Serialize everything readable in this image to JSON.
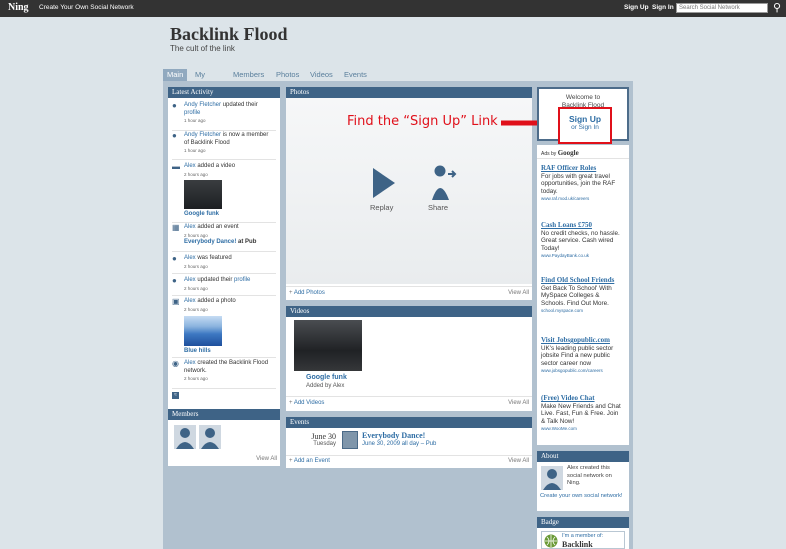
{
  "topbar": {
    "logo": "Ning",
    "create_link": "Create Your Own Social Network",
    "sign_up": "Sign Up",
    "sign_in": "Sign In",
    "search_placeholder": "Search Social Network"
  },
  "site": {
    "title": "Backlink Flood",
    "tagline": "The cult of the link"
  },
  "tabs": [
    "Main",
    "My Page",
    "Members",
    "Photos",
    "Videos",
    "Events"
  ],
  "latest_activity": {
    "header": "Latest Activity",
    "items": [
      {
        "actor": "Andy Fletcher",
        "text": "updated their",
        "link": "profile",
        "time": "1 hour ago"
      },
      {
        "actor": "Andy Fletcher",
        "text": "is now a member of Backlink Flood",
        "time": "1 hour ago"
      },
      {
        "actor": "Alex",
        "text": "added a video",
        "time": "2 hours ago",
        "caption": "Google funk"
      },
      {
        "actor": "Alex",
        "text": "added an event",
        "time": "2 hours ago",
        "caption": "Everybody Dance!",
        "caption_suffix": "at Pub"
      },
      {
        "actor": "Alex",
        "text": "was featured",
        "time": "2 hours ago"
      },
      {
        "actor": "Alex",
        "text": "updated their",
        "link": "profile",
        "time": "2 hours ago"
      },
      {
        "actor": "Alex",
        "text": "added a photo",
        "time": "2 hours ago",
        "caption": "Blue hills"
      },
      {
        "actor": "Alex",
        "text": "created the Backlink Flood network.",
        "time": "2 hours ago"
      }
    ]
  },
  "members": {
    "header": "Members",
    "view_all": "View All"
  },
  "photos": {
    "header": "Photos",
    "replay": "Replay",
    "share": "Share",
    "add": "Add Photos",
    "view_all": "View All"
  },
  "videos": {
    "header": "Videos",
    "title": "Google funk",
    "added_by": "Added by Alex",
    "add": "Add Videos",
    "view_all": "View All"
  },
  "events": {
    "header": "Events",
    "date": "June 30",
    "weekday": "Tuesday",
    "title": "Everybody Dance!",
    "detail": "June 30, 2009 all day – Pub",
    "add": "Add an Event",
    "view_all": "View All"
  },
  "annotation": {
    "text": "Find the “Sign Up” Link",
    "color": "#e0101a"
  },
  "welcome": {
    "line1": "Welcome to",
    "line2": "Backlink Flood",
    "sign_up": "Sign Up",
    "or_sign_in": "or Sign In"
  },
  "ads": {
    "label_prefix": "Ads by",
    "label_brand": "Google",
    "items": [
      {
        "title": "RAF Officer Roles",
        "body": "For jobs with great travel opportunities, join the RAF today.",
        "url": "www.raf.mod.uk/careers"
      },
      {
        "title": "Cash Loans £750",
        "body": "No credit checks, no hassle. Great service. Cash wired Today!",
        "url": "www.PaydayBank.co.uk"
      },
      {
        "title": "Find Old School Friends",
        "body": "Get Back To School' With MySpace Colleges & Schools. Find Out More.",
        "url": "school.myspace.com"
      },
      {
        "title": "Visit Jobsgopublic.com",
        "body": "UK's leading public sector jobsite Find a new public sector career now",
        "url": "www.jobsgopublic.com/careers"
      },
      {
        "title": "(Free) Video Chat",
        "body": "Make New Friends and Chat Live. Fast, Fun & Free. Join & Talk Now!",
        "url": "www.WooMe.com"
      }
    ]
  },
  "about": {
    "header": "About",
    "text": "Alex created this social network on Ning.",
    "link": "Create your own social network!"
  },
  "badge": {
    "header": "Badge",
    "line1": "I'm a member of:",
    "line2": "Backlink"
  },
  "colors": {
    "header_bg": "#3e6386",
    "page_bg": "#dce4e9",
    "link": "#2e6da4"
  }
}
